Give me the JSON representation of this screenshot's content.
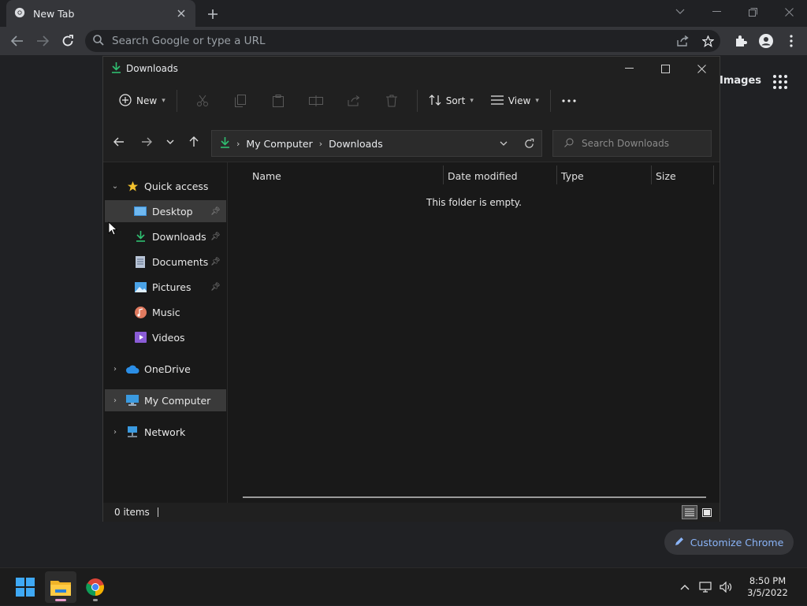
{
  "chrome": {
    "tab_title": "New Tab",
    "omnibox_placeholder": "Search Google or type a URL",
    "ntp_images": "Images",
    "customize_label": "Customize Chrome"
  },
  "explorer": {
    "title": "Downloads",
    "cmdbar": {
      "new_label": "New",
      "sort_label": "Sort",
      "view_label": "View"
    },
    "address": {
      "crumbs": [
        "My Computer",
        "Downloads"
      ]
    },
    "search_placeholder": "Search Downloads",
    "sidebar": {
      "quick_access": "Quick access",
      "items": [
        {
          "label": "Desktop",
          "pinned": true
        },
        {
          "label": "Downloads",
          "pinned": true
        },
        {
          "label": "Documents",
          "pinned": true
        },
        {
          "label": "Pictures",
          "pinned": true
        },
        {
          "label": "Music",
          "pinned": false
        },
        {
          "label": "Videos",
          "pinned": false
        }
      ],
      "onedrive": "OneDrive",
      "my_computer": "My Computer",
      "network": "Network"
    },
    "columns": [
      "Name",
      "Date modified",
      "Type",
      "Size"
    ],
    "empty_message": "This folder is empty.",
    "status_items": "0 items"
  },
  "taskbar": {
    "time": "8:50 PM",
    "date": "3/5/2022"
  },
  "colors": {
    "accent_blue": "#8ab4f8",
    "download_green": "#2fbf71",
    "star_yellow": "#f2c12e"
  }
}
